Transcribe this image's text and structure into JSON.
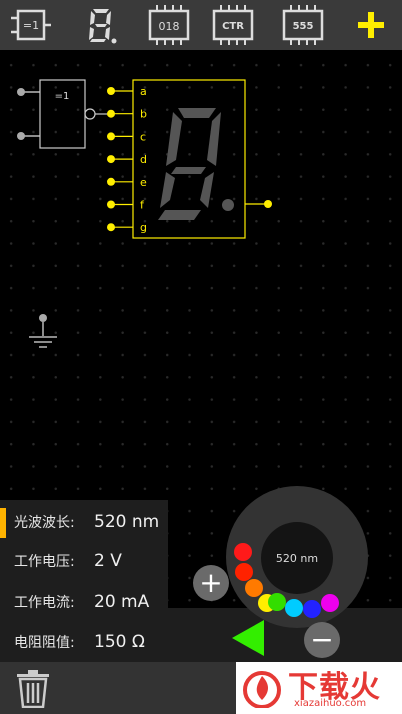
{
  "toolbar": {
    "items": [
      {
        "name": "xor-gate-tool-icon",
        "label": "=1"
      },
      {
        "name": "seven-segment-tool-icon",
        "label": "8."
      },
      {
        "name": "counter-chip-tool-icon",
        "label": "018"
      },
      {
        "name": "ctr-chip-tool-icon",
        "label": "CTR"
      },
      {
        "name": "timer-555-chip-tool-icon",
        "label": "555"
      },
      {
        "name": "add-icon",
        "label": "+"
      }
    ]
  },
  "circuit": {
    "xor_gate_label": "=1",
    "segment_pins": [
      "a",
      "b",
      "c",
      "d",
      "e",
      "f",
      "g"
    ],
    "display_digit": "8."
  },
  "params": [
    {
      "label": "光波波长:",
      "value": "520 nm",
      "active": true
    },
    {
      "label": "工作电压:",
      "value": "2 V",
      "active": false
    },
    {
      "label": "工作电流:",
      "value": "20 mA",
      "active": false
    },
    {
      "label": "电阻阻值:",
      "value": "150 Ω",
      "active": false
    }
  ],
  "dial": {
    "readout": "520 nm",
    "color_dots": [
      "#ff1a1a",
      "#ff2200",
      "#ff7a00",
      "#ffee00",
      "#33dd00",
      "#00ccff",
      "#2222ff",
      "#ee00ee"
    ]
  },
  "controls": {
    "plus_label": "+",
    "minus_label": "−",
    "play_color": "#33ee00"
  },
  "watermark": {
    "cn": "下载火",
    "en": "xiazaihuo.com",
    "color": "#e53935"
  },
  "colors": {
    "accent": "#ffee00",
    "active_bar": "#ffb300"
  }
}
